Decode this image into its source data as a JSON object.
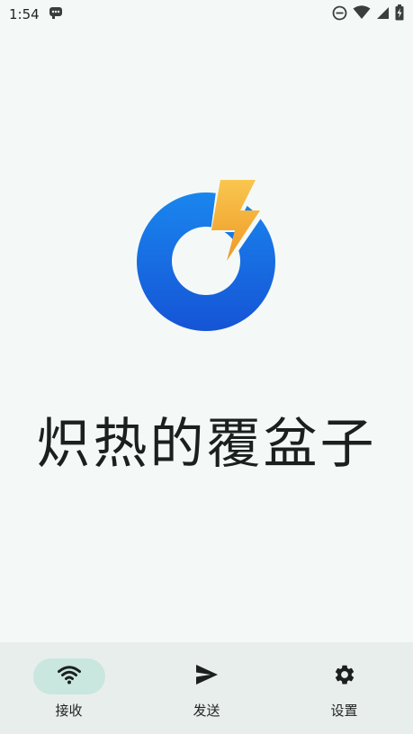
{
  "status_bar": {
    "time": "1:54",
    "icons": [
      "notification-icon",
      "do-not-disturb-icon",
      "wifi-icon",
      "signal-icon",
      "battery-icon"
    ]
  },
  "app": {
    "title": "炽热的覆盆子",
    "logo": "app-logo",
    "accent": "#1f6fe5",
    "bolt_color": "#f4b23a"
  },
  "bottom_nav": {
    "items": [
      {
        "label": "接收",
        "icon": "wifi-icon",
        "active": true
      },
      {
        "label": "发送",
        "icon": "send-icon",
        "active": false
      },
      {
        "label": "设置",
        "icon": "gear-icon",
        "active": false
      }
    ]
  }
}
